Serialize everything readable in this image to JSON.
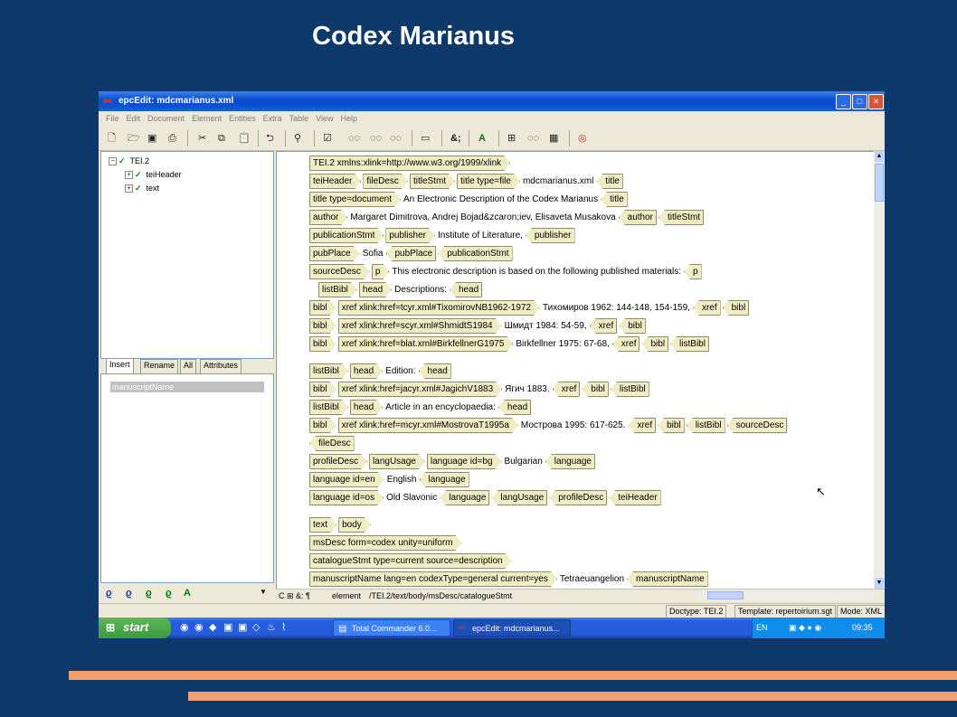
{
  "slide": {
    "title": "Codex Marianus"
  },
  "window": {
    "title": "epcEdit: mdcmarianus.xml",
    "menu": [
      "File",
      "Edit",
      "Document",
      "Element",
      "Entities",
      "Extra",
      "Table",
      "View",
      "Help"
    ]
  },
  "toolbar": {
    "icons": [
      "new-document-icon",
      "open-folder-icon",
      "save-icon",
      "print-icon",
      "cut-icon",
      "copy-icon",
      "paste-icon",
      "undo-icon",
      "find-icon",
      "validate-icon",
      "insert-element-icon",
      "insert-before-icon",
      "insert-after-icon",
      "entity-icon",
      "attribute-icon",
      "tree-view-icon",
      "tag-view-icon",
      "table-view-icon",
      "help-lifebuoy-icon"
    ]
  },
  "tree": {
    "root": "TEI.2",
    "children": [
      "teiHeader",
      "text"
    ]
  },
  "tabs": [
    "Insert",
    "Rename",
    "All",
    "Attributes"
  ],
  "insert_list": [
    "manuscriptName"
  ],
  "xml_rows": [
    [
      {
        "k": "tag",
        "t": "TEI.2 xmlns:xlink=http://www.w3.org/1999/xlink"
      }
    ],
    [
      {
        "k": "tag",
        "t": "teiHeader"
      },
      {
        "k": "tag",
        "t": "fileDesc"
      },
      {
        "k": "tag",
        "t": "titleStmt"
      },
      {
        "k": "tag",
        "t": "title type=file"
      },
      {
        "k": "txt",
        "t": "mdcmarianus.xml"
      },
      {
        "k": "end",
        "t": "title"
      }
    ],
    [
      {
        "k": "tag",
        "t": "title type=document"
      },
      {
        "k": "txt",
        "t": "An Electronic Description of the Codex Marianus"
      },
      {
        "k": "end",
        "t": "title"
      }
    ],
    [
      {
        "k": "tag",
        "t": "author"
      },
      {
        "k": "txt",
        "t": "Margaret Dimitrova, Andrej Bojad&zcaron;iev, Elisaveta Musakova"
      },
      {
        "k": "end",
        "t": "author"
      },
      {
        "k": "end",
        "t": "titleStmt"
      }
    ],
    [
      {
        "k": "tag",
        "t": "publicationStmt"
      },
      {
        "k": "tag",
        "t": "publisher"
      },
      {
        "k": "txt",
        "t": "Institute of Literature,"
      },
      {
        "k": "end",
        "t": "publisher"
      }
    ],
    [
      {
        "k": "tag",
        "t": "pubPlace"
      },
      {
        "k": "txt",
        "t": "Sofia"
      },
      {
        "k": "end",
        "t": "pubPlace"
      },
      {
        "k": "end",
        "t": "publicationStmt"
      }
    ],
    [
      {
        "k": "tag",
        "t": "sourceDesc"
      },
      {
        "k": "tag",
        "t": "p"
      },
      {
        "k": "txt",
        "t": "This electronic description is based on the following published materials:"
      },
      {
        "k": "end",
        "t": "p"
      }
    ],
    [
      {
        "k": "tag",
        "t": "listBibl",
        "indent": true
      },
      {
        "k": "tag",
        "t": "head"
      },
      {
        "k": "txt",
        "t": "Descriptions:"
      },
      {
        "k": "end",
        "t": "head"
      }
    ],
    [
      {
        "k": "tag",
        "t": "bibl"
      },
      {
        "k": "tag",
        "t": "xref xlink:href=tcyr.xml#TixomirovNB1962-1972"
      },
      {
        "k": "txt",
        "t": "Тихомиров 1962: 144-148, 154-159,"
      },
      {
        "k": "end",
        "t": "xref"
      },
      {
        "k": "end",
        "t": "bibl"
      }
    ],
    [
      {
        "k": "tag",
        "t": "bibl"
      },
      {
        "k": "tag",
        "t": "xref xlink:href=scyr.xml#ShmidtS1984"
      },
      {
        "k": "txt",
        "t": "Шмидт 1984: 54-59,"
      },
      {
        "k": "end",
        "t": "xref"
      },
      {
        "k": "end",
        "t": "bibl"
      }
    ],
    [
      {
        "k": "tag",
        "t": "bibl"
      },
      {
        "k": "tag",
        "t": "xref xlink:href=blat.xml#BirkfellnerG1975"
      },
      {
        "k": "txt",
        "t": "Birkfellner 1975: 67-68,"
      },
      {
        "k": "end",
        "t": "xref"
      },
      {
        "k": "end",
        "t": "bibl"
      },
      {
        "k": "end",
        "t": "listBibl"
      }
    ],
    [
      {
        "k": "tag",
        "t": "listBibl"
      },
      {
        "k": "tag",
        "t": "head"
      },
      {
        "k": "txt",
        "t": "Edition:"
      },
      {
        "k": "end",
        "t": "head"
      }
    ],
    [
      {
        "k": "tag",
        "t": "bibl"
      },
      {
        "k": "tag",
        "t": "xref xlink:href=jacyr.xml#JagichV1883"
      },
      {
        "k": "txt",
        "t": "Ягич 1883."
      },
      {
        "k": "end",
        "t": "xref"
      },
      {
        "k": "end",
        "t": "bibl"
      },
      {
        "k": "end",
        "t": "listBibl"
      }
    ],
    [
      {
        "k": "tag",
        "t": "listBibl"
      },
      {
        "k": "tag",
        "t": "head"
      },
      {
        "k": "txt",
        "t": "Article in an encyclopaedia:"
      },
      {
        "k": "end",
        "t": "head"
      }
    ],
    [
      {
        "k": "tag",
        "t": "bibl"
      },
      {
        "k": "tag",
        "t": "xref xlink:href=mcyr.xml#MostrovaT1995a"
      },
      {
        "k": "txt",
        "t": "Мострова 1995: 617-625."
      },
      {
        "k": "end",
        "t": "xref"
      },
      {
        "k": "end",
        "t": "bibl"
      },
      {
        "k": "end",
        "t": "listBibl"
      },
      {
        "k": "end",
        "t": "sourceDesc"
      }
    ],
    [
      {
        "k": "end",
        "t": "fileDesc"
      }
    ],
    [
      {
        "k": "tag",
        "t": "profileDesc"
      },
      {
        "k": "tag",
        "t": "langUsage"
      },
      {
        "k": "tag",
        "t": "language id=bg"
      },
      {
        "k": "txt",
        "t": "Bulgarian"
      },
      {
        "k": "end",
        "t": "language"
      }
    ],
    [
      {
        "k": "tag",
        "t": "language id=en"
      },
      {
        "k": "txt",
        "t": "English"
      },
      {
        "k": "end",
        "t": "language"
      }
    ],
    [
      {
        "k": "tag",
        "t": "language id=os"
      },
      {
        "k": "txt",
        "t": "Old Slavonic"
      },
      {
        "k": "end",
        "t": "language"
      },
      {
        "k": "end",
        "t": "langUsage"
      },
      {
        "k": "end",
        "t": "profileDesc"
      },
      {
        "k": "end",
        "t": "teiHeader"
      }
    ],
    [
      {
        "k": "tag",
        "t": "text"
      },
      {
        "k": "tag",
        "t": "body"
      }
    ],
    [
      {
        "k": "tag",
        "t": "msDesc form=codex unity=uniform"
      }
    ],
    [
      {
        "k": "tag",
        "t": "catalogueStmt type=current source=description"
      }
    ],
    [
      {
        "k": "tag",
        "t": "manuscriptName lang=en codexType=general current=yes"
      },
      {
        "k": "txt",
        "t": "Tetraeuangelion"
      },
      {
        "k": "end",
        "t": "manuscriptName"
      }
    ]
  ],
  "status_strip": {
    "symbols": "C ⊞ &: ¶",
    "element_label": "element",
    "path": "/TEI.2/text/body/msDesc/catalogueStmt"
  },
  "statusbar": {
    "doctype": "Doctype: TEI.2",
    "template": "Template: repertoirium.sgt",
    "mode": "Mode: XML"
  },
  "taskbar": {
    "start_label": "start",
    "tasks": [
      "Total Commander 6.0...",
      "epcEdit: mdcmarianus..."
    ],
    "lang": "EN",
    "clock": "09:35"
  },
  "colors": {
    "background": "#0d3a6b",
    "accent_bar": "#f59e6b",
    "tag_fill": "#f0ecc4"
  }
}
